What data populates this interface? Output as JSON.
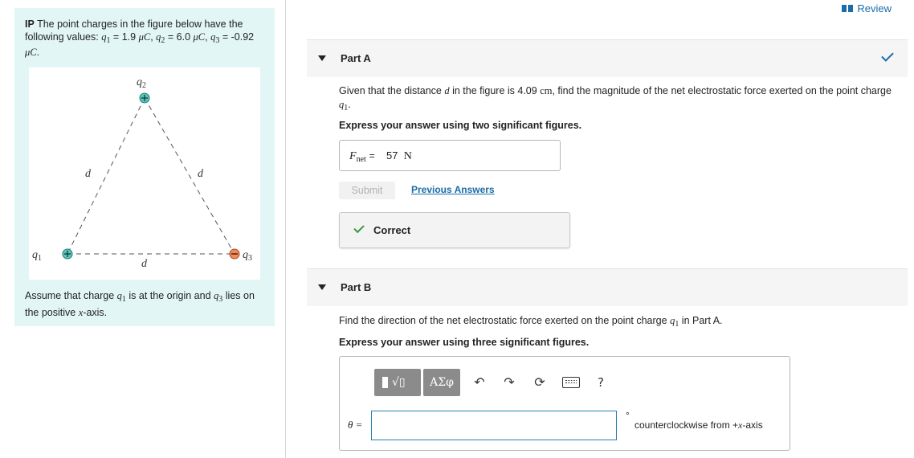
{
  "left_panel": {
    "intro_prefix": "IP",
    "intro_text": "The point charges in the figure below have the following values:",
    "q1_value": "1.9",
    "q2_value": "6.0",
    "q3_value": "-0.92",
    "unit": "μC",
    "figure": {
      "labels": {
        "q1": "q",
        "q2": "q",
        "q3": "q",
        "side": "d"
      },
      "subscripts": {
        "q1": "1",
        "q2": "2",
        "q3": "3"
      },
      "colors": {
        "positive": "#2a9d8f",
        "negative": "#e0734a",
        "line": "#555555"
      }
    },
    "assume_text_a": "Assume that charge",
    "assume_text_b": "is at the origin and",
    "assume_text_c": "lies on the positive",
    "assume_axis": "x",
    "assume_text_d": "-axis."
  },
  "review_label": "Review",
  "part_a": {
    "title": "Part A",
    "question_a": "Given that the distance",
    "question_var": "d",
    "question_b": "in the figure is 4.09",
    "question_unit": "cm",
    "question_c": ", find the magnitude of the net electrostatic force exerted on the point charge",
    "question_end": ".",
    "instruction": "Express your answer using two significant figures.",
    "answer_lhs": "F",
    "answer_sub": "net",
    "answer_eq": "=",
    "answer_value": "57",
    "answer_unit": "N",
    "submit_label": "Submit",
    "previous_label": "Previous Answers",
    "feedback": "Correct"
  },
  "part_b": {
    "title": "Part B",
    "question_a": "Find the direction of the net electrostatic force exerted on the point charge",
    "question_b": "in Part A.",
    "instruction": "Express your answer using three significant figures.",
    "toolbar": {
      "sqrt_label": "√▯",
      "greek_label": "ΑΣφ",
      "undo_icon": "↶",
      "redo_icon": "↷",
      "reset_icon": "⟳",
      "help_label": "?"
    },
    "theta_label": "θ =",
    "answer_value": "",
    "degree_symbol": "°",
    "unit_text": "counterclockwise from +",
    "unit_axis": "x",
    "unit_suffix": "-axis"
  }
}
